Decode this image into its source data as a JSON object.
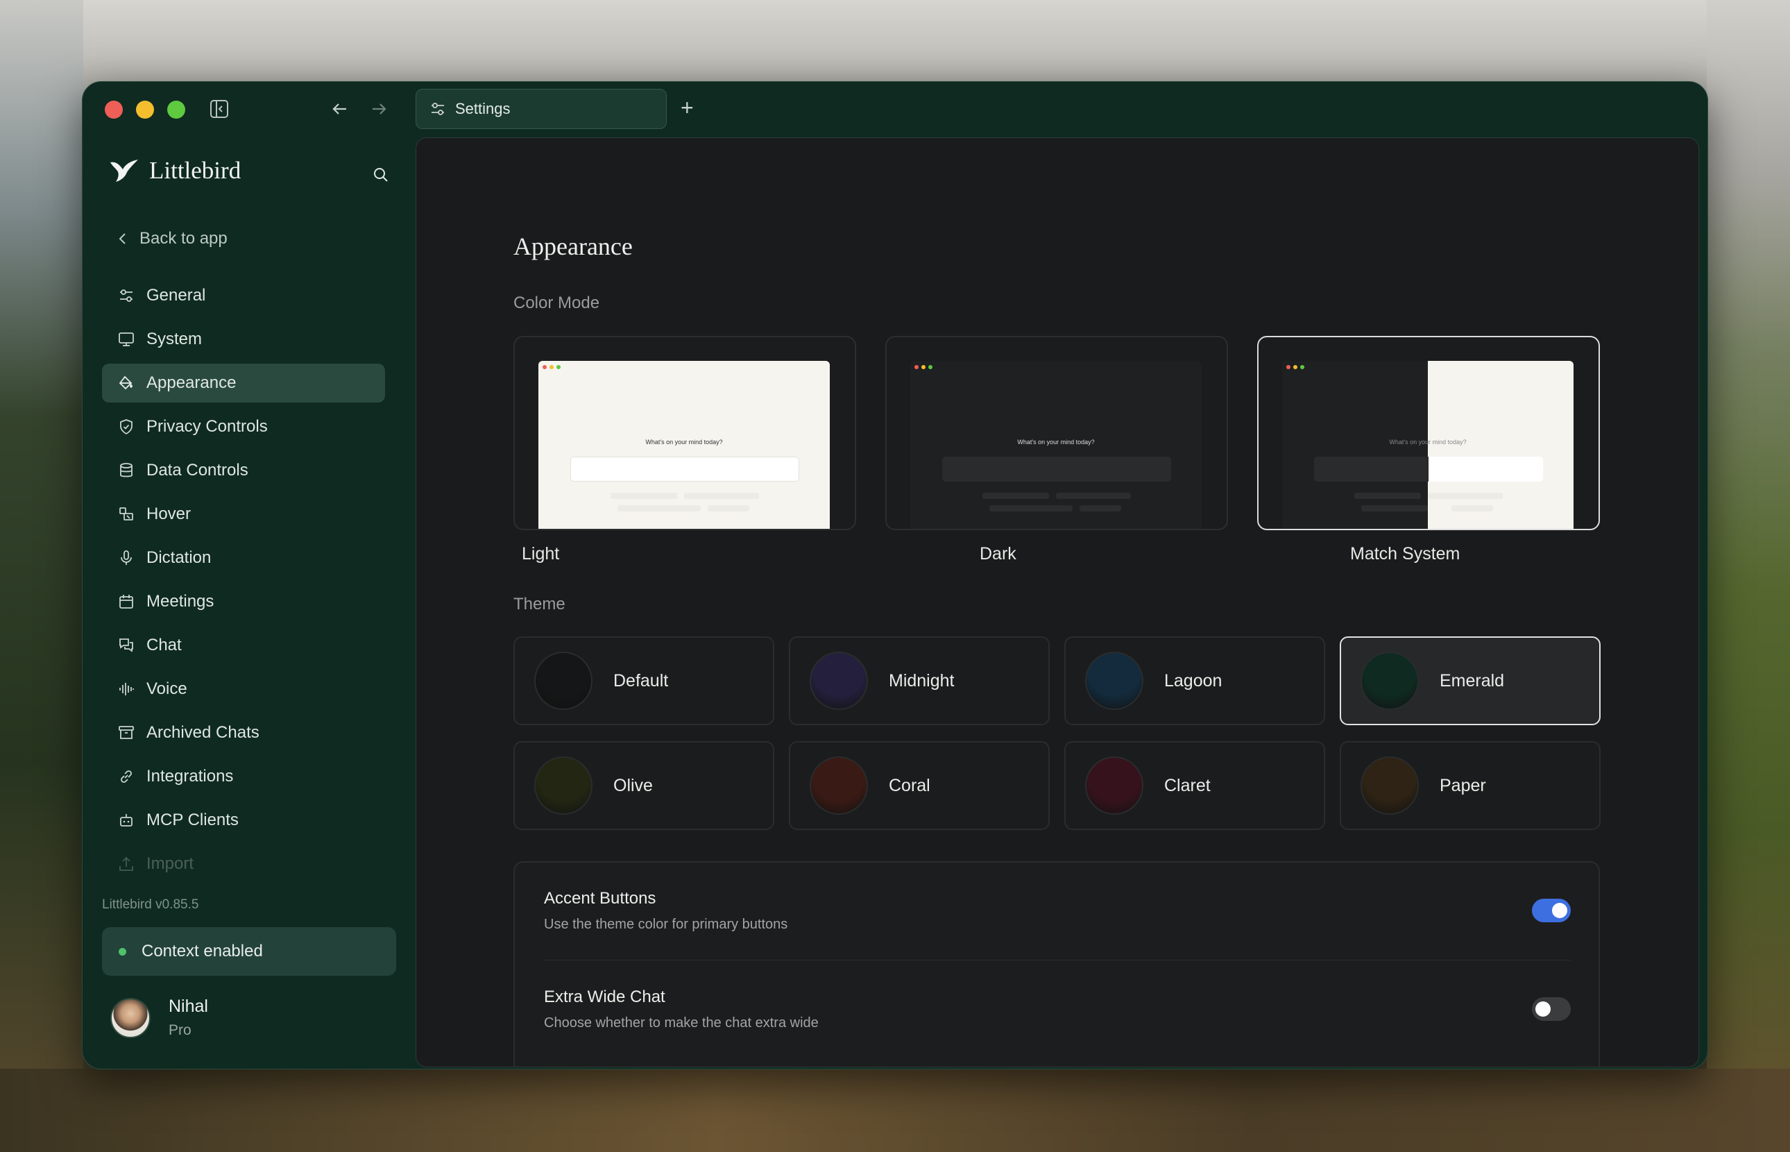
{
  "tab": {
    "label": "Settings"
  },
  "sidebar": {
    "brand": "Littlebird",
    "back_label": "Back to app",
    "items": [
      {
        "label": "General",
        "icon": "sliders-icon"
      },
      {
        "label": "System",
        "icon": "monitor-icon"
      },
      {
        "label": "Appearance",
        "icon": "paint-bucket-icon",
        "active": true
      },
      {
        "label": "Privacy Controls",
        "icon": "shield-icon"
      },
      {
        "label": "Data Controls",
        "icon": "database-icon"
      },
      {
        "label": "Hover",
        "icon": "hover-icon"
      },
      {
        "label": "Dictation",
        "icon": "microphone-icon"
      },
      {
        "label": "Meetings",
        "icon": "calendar-icon"
      },
      {
        "label": "Chat",
        "icon": "chat-bubbles-icon"
      },
      {
        "label": "Voice",
        "icon": "waveform-icon"
      },
      {
        "label": "Archived Chats",
        "icon": "archive-icon"
      },
      {
        "label": "Integrations",
        "icon": "link-icon"
      },
      {
        "label": "MCP Clients",
        "icon": "robot-icon"
      },
      {
        "label": "Import",
        "icon": "upload-icon"
      }
    ],
    "version": "Littlebird v0.85.5",
    "context_status": "Context enabled",
    "user": {
      "name": "Nihal",
      "plan": "Pro"
    }
  },
  "main": {
    "title": "Appearance",
    "color_mode_label": "Color Mode",
    "color_modes": [
      {
        "label": "Light",
        "selected": false
      },
      {
        "label": "Dark",
        "selected": false
      },
      {
        "label": "Match System",
        "selected": true
      }
    ],
    "preview_question": "What's on your mind today?",
    "theme_label": "Theme",
    "themes": [
      {
        "name": "Default",
        "color": "#151617",
        "selected": false
      },
      {
        "name": "Midnight",
        "color": "#241f3c",
        "selected": false
      },
      {
        "name": "Lagoon",
        "color": "#132b3c",
        "selected": false
      },
      {
        "name": "Emerald",
        "color": "#0f2a20",
        "selected": true
      },
      {
        "name": "Olive",
        "color": "#232612",
        "selected": false
      },
      {
        "name": "Coral",
        "color": "#3a1a14",
        "selected": false
      },
      {
        "name": "Claret",
        "color": "#36121d",
        "selected": false
      },
      {
        "name": "Paper",
        "color": "#2e2314",
        "selected": false
      }
    ],
    "settings": [
      {
        "title": "Accent Buttons",
        "description": "Use the theme color for primary buttons",
        "enabled": true
      },
      {
        "title": "Extra Wide Chat",
        "description": "Choose whether to make the chat extra wide",
        "enabled": false
      }
    ]
  },
  "colors": {
    "window_bg": "#0f2a21",
    "accent_toggle": "#3d6fe0",
    "active_nav": "#2a4a3f"
  }
}
